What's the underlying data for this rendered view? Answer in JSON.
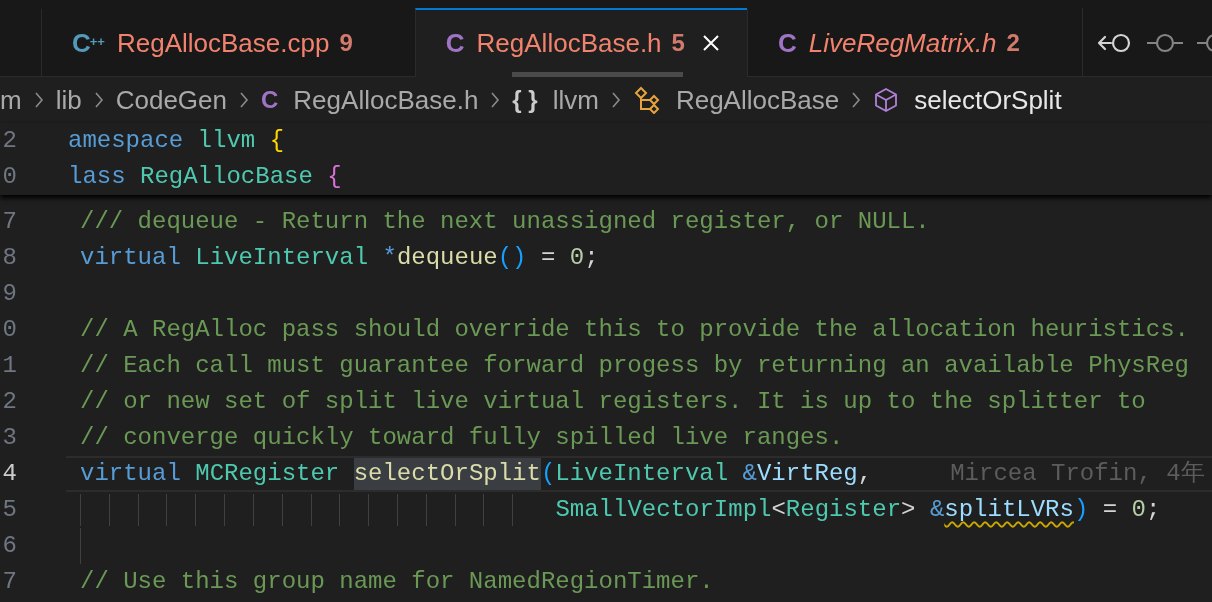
{
  "tabs": [
    {
      "icon": "C$^{++}$",
      "kind": "cpp",
      "label": "RegAllocBase.cpp",
      "problems": "9",
      "error": true,
      "preview": false,
      "selected": false
    },
    {
      "icon": "C",
      "kind": "header",
      "label": "RegAllocBase.h",
      "problems": "5",
      "error": true,
      "preview": false,
      "selected": true
    },
    {
      "icon": "C",
      "kind": "header",
      "label": "LiveRegMatrix.h",
      "problems": "2",
      "error": true,
      "preview": true,
      "selected": false
    }
  ],
  "toolbar": [
    {
      "kind": "previous",
      "disabled": false
    },
    {
      "kind": "commit",
      "disabled": true
    },
    {
      "kind": "commit",
      "disabled": true
    }
  ],
  "breadcrumbs": [
    {
      "kind": "folder",
      "label": "m",
      "selected": false
    },
    {
      "kind": "folder",
      "label": "lib",
      "selected": false
    },
    {
      "kind": "folder",
      "label": "CodeGen",
      "selected": false
    },
    {
      "kind": "file",
      "icon": "C",
      "label": "RegAllocBase.h",
      "selected": false
    },
    {
      "kind": "namespace",
      "icon": "{ }",
      "label": "llvm",
      "selected": false
    },
    {
      "kind": "class",
      "label": "RegAllocBase",
      "selected": false
    },
    {
      "kind": "method",
      "label": "selectOrSplit",
      "selected": true
    }
  ],
  "sticky_lines": [
    {
      "number": "2",
      "current": false,
      "tokens": [
        {
          "text": "amespace",
          "kind": "keyword"
        },
        {
          "text": " llvm",
          "kind": "type"
        },
        {
          "text": " {",
          "kind": "bracket1"
        }
      ]
    },
    {
      "number": "0",
      "current": false,
      "tokens": [
        {
          "text": "lass",
          "kind": "keyword"
        },
        {
          "text": " RegAllocBase",
          "kind": "type"
        },
        {
          "text": " {",
          "kind": "bracket2"
        }
      ]
    }
  ],
  "lines": [
    {
      "number": "7",
      "current": false,
      "indent_guides": false,
      "tokens": [
        {
          "text": "/// dequeue - Return the next unassigned register, or NULL.",
          "kind": "comment"
        }
      ]
    },
    {
      "number": "8",
      "current": false,
      "indent_guides": false,
      "tokens": [
        {
          "text": "virtual",
          "kind": "keyword"
        },
        {
          "text": " LiveInterval",
          "kind": "type"
        },
        {
          "text": " *",
          "kind": "operator"
        },
        {
          "text": "dequeue",
          "kind": "function"
        },
        {
          "text": "()",
          "kind": "bracket3"
        },
        {
          "text": " = ",
          "kind": "plain"
        },
        {
          "text": "0",
          "kind": "number"
        },
        {
          "text": ";",
          "kind": "plain"
        }
      ]
    },
    {
      "number": "9",
      "current": false,
      "indent_guides": false
    },
    {
      "number": "0",
      "current": false,
      "indent_guides": false,
      "tokens": [
        {
          "text": "// A RegAlloc pass should override this to provide the allocation heuristics.",
          "kind": "comment"
        }
      ]
    },
    {
      "number": "1",
      "current": false,
      "indent_guides": false,
      "tokens": [
        {
          "text": "// Each call must guarantee forward progess by returning an available PhysReg",
          "kind": "comment"
        }
      ]
    },
    {
      "number": "2",
      "current": false,
      "indent_guides": false,
      "tokens": [
        {
          "text": "// or new set of split live virtual registers. It is up to the splitter to",
          "kind": "comment"
        }
      ]
    },
    {
      "number": "3",
      "current": false,
      "indent_guides": false,
      "tokens": [
        {
          "text": "// converge quickly toward fully spilled live ranges.",
          "kind": "comment"
        }
      ]
    },
    {
      "number": "4",
      "current": true,
      "indent_guides": false,
      "blame": "Mircea Trofin, 4年",
      "tokens": [
        {
          "text": "virtual",
          "kind": "keyword",
          "highlighted": false
        },
        {
          "text": " MCRegister ",
          "kind": "type",
          "highlighted": false
        },
        {
          "text": "selectOrSplit",
          "kind": "function",
          "highlighted": true
        },
        {
          "text": "(",
          "kind": "bracket3",
          "highlighted": false
        },
        {
          "text": "LiveInterval",
          "kind": "type",
          "highlighted": false
        },
        {
          "text": " &",
          "kind": "operator",
          "highlighted": false
        },
        {
          "text": "VirtReg",
          "kind": "parameter",
          "highlighted": false
        },
        {
          "text": ",",
          "kind": "plain",
          "highlighted": false
        }
      ]
    },
    {
      "number": "5",
      "current": false,
      "indent_guides": true,
      "tokens": [
        {
          "text": "                                 SmallVectorImpl",
          "kind": "type",
          "warning": false
        },
        {
          "text": "<",
          "kind": "plain",
          "warning": false
        },
        {
          "text": "Register",
          "kind": "type",
          "warning": false
        },
        {
          "text": ">",
          "kind": "plain",
          "warning": false
        },
        {
          "text": " &",
          "kind": "operator",
          "warning": false
        },
        {
          "text": "splitLVRs",
          "kind": "parameter",
          "warning": true
        },
        {
          "text": ")",
          "kind": "bracket3",
          "warning": false
        },
        {
          "text": " = ",
          "kind": "plain",
          "warning": false
        },
        {
          "text": "0",
          "kind": "number",
          "warning": false
        },
        {
          "text": ";",
          "kind": "plain",
          "warning": false
        }
      ]
    },
    {
      "number": "6",
      "current": false,
      "indent_guides": true
    },
    {
      "number": "7",
      "current": false,
      "indent_guides": false,
      "tokens": [
        {
          "text": "// Use this group name for NamedRegionTimer.",
          "kind": "comment"
        }
      ]
    }
  ]
}
